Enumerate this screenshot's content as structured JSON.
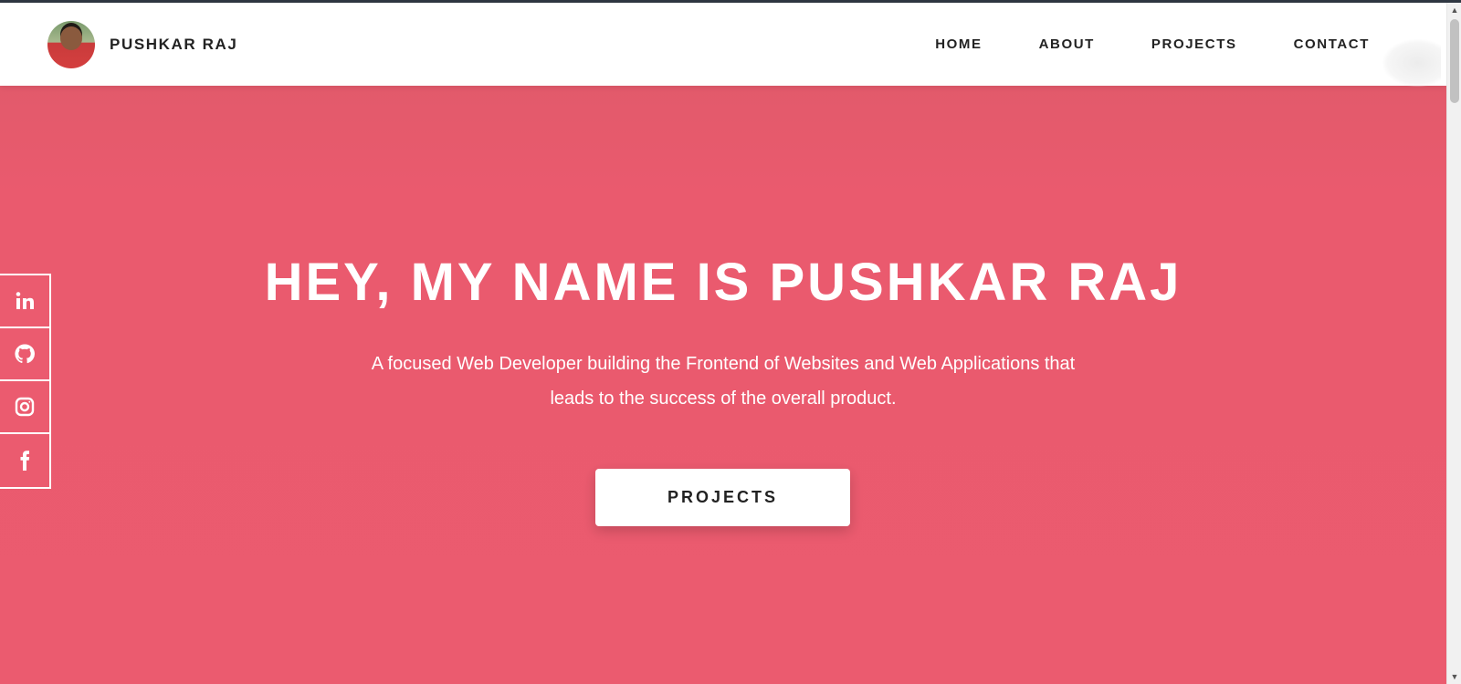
{
  "header": {
    "brand_name": "PUSHKAR RAJ",
    "nav": [
      {
        "label": "HOME"
      },
      {
        "label": "ABOUT"
      },
      {
        "label": "PROJECTS"
      },
      {
        "label": "CONTACT"
      }
    ]
  },
  "hero": {
    "title": "HEY, MY NAME IS PUSHKAR RAJ",
    "subtitle_line1": "A focused Web Developer building the Frontend of Websites and Web Applications that",
    "subtitle_line2": "leads to the success of the overall product.",
    "cta_label": "PROJECTS"
  },
  "social": {
    "icons": [
      "linkedin-icon",
      "github-icon",
      "instagram-icon",
      "facebook-icon"
    ]
  },
  "colors": {
    "hero_background": "#eb5b6f",
    "header_background": "#ffffff",
    "text_dark": "#222222"
  }
}
